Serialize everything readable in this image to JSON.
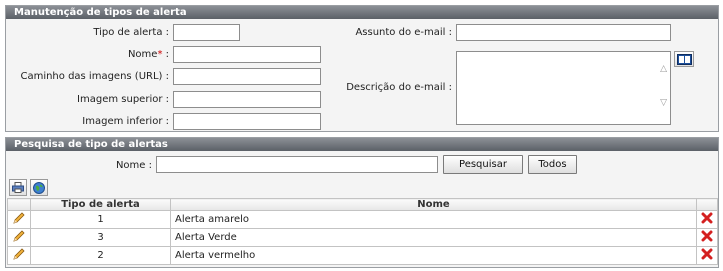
{
  "maintenance": {
    "title": "Manutenção de tipos de alerta",
    "tipo_label": "Tipo de alerta :",
    "nome_label": "Nome",
    "required_mark": "*",
    "nome_suffix": " :",
    "caminho_label": "Caminho das imagens (URL) :",
    "imagem_superior_label": "Imagem superior :",
    "imagem_inferior_label": "Imagem inferior :",
    "assunto_label": "Assunto do e-mail :",
    "descricao_label": "Descrição do e-mail :",
    "fields": {
      "tipo": "",
      "nome": "",
      "caminho": "",
      "imagem_superior": "",
      "imagem_inferior": "",
      "assunto": "",
      "descricao": ""
    },
    "book_icon": "book-icon"
  },
  "search": {
    "title": "Pesquisa de tipo de alertas",
    "nome_label": "Nome :",
    "nome_value": "",
    "search_button": "Pesquisar",
    "all_button": "Todos",
    "toolbar_icons": [
      "print-icon",
      "globe-icon"
    ]
  },
  "table": {
    "columns": [
      "Tipo de alerta",
      "Nome"
    ],
    "rows": [
      {
        "tipo": "1",
        "nome": "Alerta amarelo"
      },
      {
        "tipo": "3",
        "nome": "Alerta Verde"
      },
      {
        "tipo": "2",
        "nome": "Alerta vermelho"
      }
    ],
    "edit_icon": "pencil-icon",
    "delete_icon": "delete-x-icon"
  },
  "colors": {
    "header_bg": "#6e7278",
    "delete_red": "#d42020",
    "required_red": "#cc0000"
  }
}
